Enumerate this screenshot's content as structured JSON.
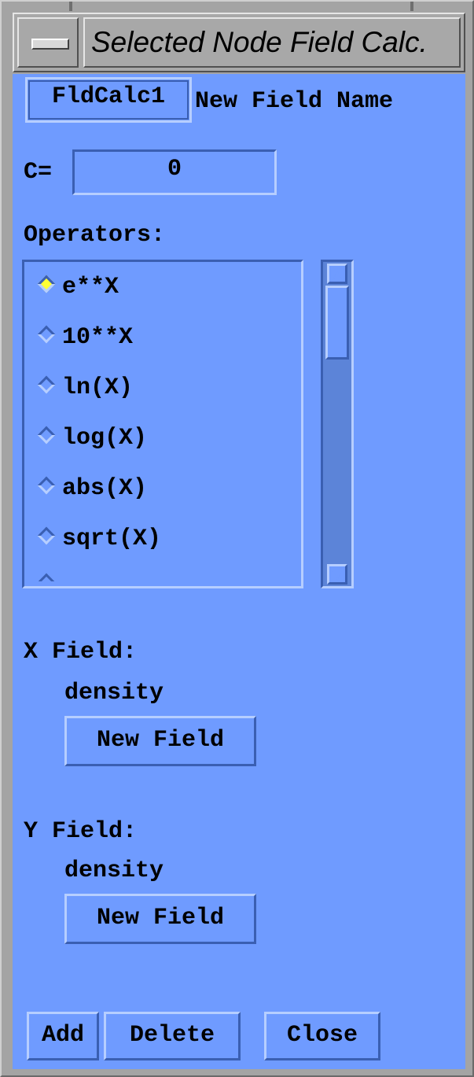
{
  "window": {
    "title": "Selected Node Field Calc."
  },
  "header": {
    "field_name_value": "FldCalc1",
    "field_name_label": "New Field Name"
  },
  "constant": {
    "label": "C=",
    "value": "0"
  },
  "operators": {
    "label": "Operators:",
    "items": [
      "e**X",
      "10**X",
      "ln(X)",
      "log(X)",
      "abs(X)",
      "sqrt(X)"
    ],
    "selected": "e**X"
  },
  "x_field": {
    "label": "X Field:",
    "value": "density",
    "button": "New Field"
  },
  "y_field": {
    "label": "Y Field:",
    "value": "density",
    "button": "New Field"
  },
  "footer": {
    "add": "Add",
    "delete": "Delete",
    "close": "Close"
  },
  "colors": {
    "panel": "#6f9bff",
    "selected_radio": "#ffff33",
    "frame": "#a4a4a4"
  }
}
